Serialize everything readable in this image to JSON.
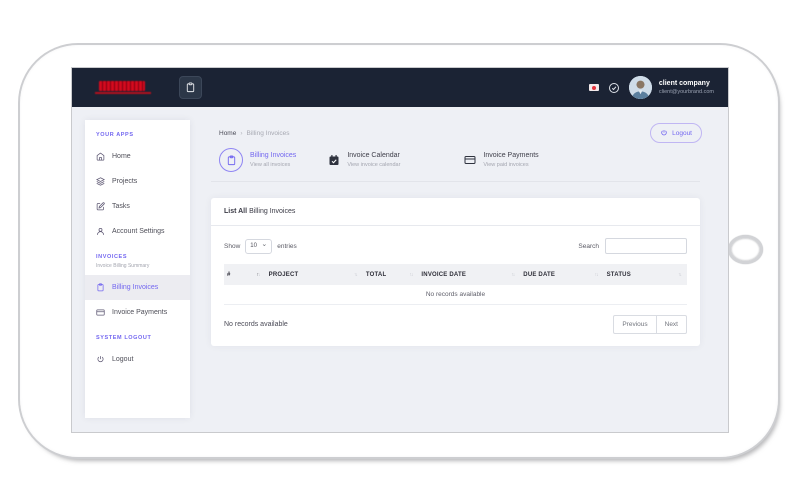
{
  "colors": {
    "accent": "#7367f0",
    "topbar_bg": "#1b2334",
    "screen_bg": "#eef0f5"
  },
  "topbar": {
    "user_name": "client company",
    "user_email": "client@yourbrand.com"
  },
  "sidebar": {
    "section_apps": "YOUR APPS",
    "apps": [
      {
        "label": "Home"
      },
      {
        "label": "Projects"
      },
      {
        "label": "Tasks"
      },
      {
        "label": "Account Settings"
      }
    ],
    "section_invoices": "INVOICES",
    "section_invoices_subtitle": "Invoice Billing Summary",
    "invoices": [
      {
        "label": "Billing Invoices"
      },
      {
        "label": "Invoice Payments"
      }
    ],
    "section_system": "SYSTEM LOGOUT",
    "logout_label": "Logout"
  },
  "breadcrumb": {
    "home": "Home",
    "separator": "›",
    "current": "Billing Invoices"
  },
  "logout_button_label": "Logout",
  "tabs": [
    {
      "label": "Billing Invoices",
      "sublabel": "View all invoices"
    },
    {
      "label": "Invoice Calendar",
      "sublabel": "View invoice calendar"
    },
    {
      "label": "Invoice Payments",
      "sublabel": "View paid invoices"
    }
  ],
  "card": {
    "title_bold": "List All",
    "title_rest": "Billing Invoices",
    "show_label": "Show",
    "page_size": "10",
    "entries_label": "entries",
    "search_label": "Search",
    "columns": [
      "#",
      "PROJECT",
      "TOTAL",
      "INVOICE DATE",
      "DUE DATE",
      "STATUS"
    ],
    "empty_text": "No records available",
    "footer_status": "No records available",
    "prev_label": "Previous",
    "next_label": "Next"
  }
}
